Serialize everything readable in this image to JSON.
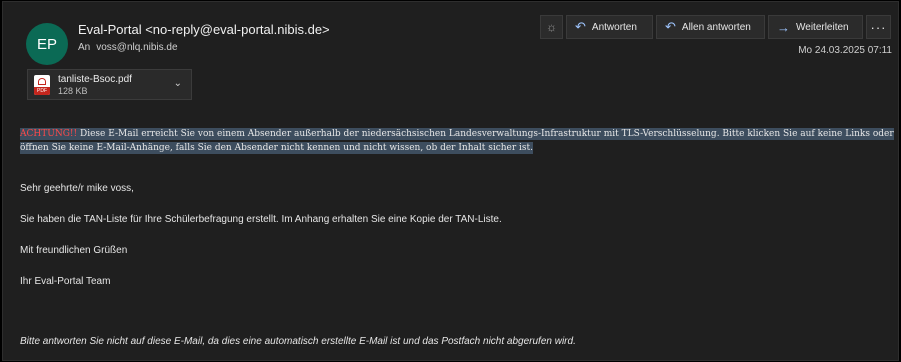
{
  "header": {
    "avatar_initials": "EP",
    "from": "Eval-Portal <no-reply@eval-portal.nibis.de>",
    "to_label": "An",
    "to_address": "voss@nlq.nibis.de",
    "date": "Mo 24.03.2025 07:11"
  },
  "toolbar": {
    "sun_icon": "sun-icon",
    "reply_label": "Antworten",
    "reply_all_label": "Allen antworten",
    "forward_label": "Weiterleiten",
    "more_label": "···"
  },
  "attachment": {
    "name": "tanliste-Bsoc.pdf",
    "size": "128 KB",
    "type_badge": "PDF"
  },
  "warning": {
    "prefix": "ACHTUNG!!",
    "text": " Diese E-Mail erreicht Sie von einem Absender außerhalb der niedersächsischen Landesverwaltungs-Infrastruktur mit TLS-Verschlüsselung. Bitte klicken Sie auf keine Links oder öffnen Sie keine E-Mail-Anhänge, falls Sie den Absender nicht kennen und nicht wissen, ob der Inhalt sicher ist."
  },
  "body": {
    "greeting": "Sehr geehrte/r mike voss,",
    "paragraph": "Sie haben die TAN-Liste für Ihre Schülerbefragung erstellt. Im Anhang erhalten Sie eine Kopie der TAN-Liste.",
    "closing": "Mit freundlichen Grüßen",
    "signature": "Ihr Eval-Portal Team",
    "footer": "Bitte antworten Sie nicht auf diese E-Mail, da dies eine automatisch erstellte E-Mail ist und das Postfach nicht abgerufen wird."
  },
  "colors": {
    "avatar_bg": "#0b6a55",
    "warning_red": "#ff4a4a",
    "highlight_bg": "#3d4d5e",
    "accent_blue": "#9ec5ff"
  }
}
